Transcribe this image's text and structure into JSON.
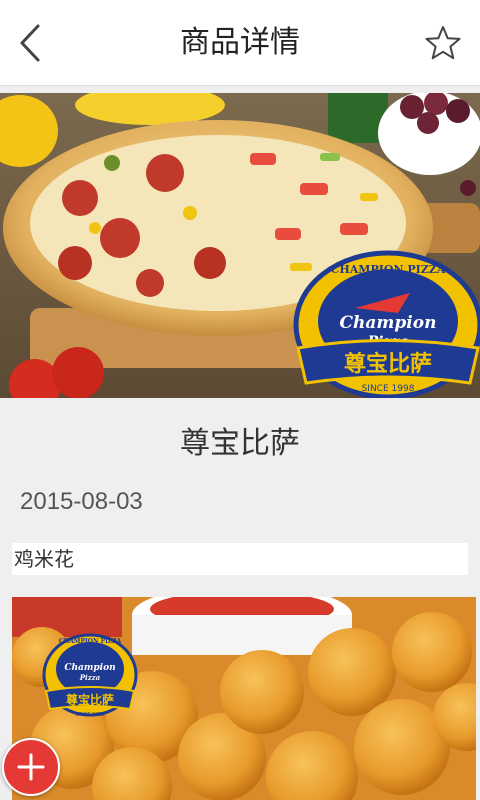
{
  "header": {
    "title": "商品详情",
    "back_icon": "chevron-left-icon",
    "favorite_icon": "star-outline-icon"
  },
  "hero": {
    "image": "pizza-photo",
    "logo": {
      "arc_text": "CHAMPION PIZZA",
      "script_line1": "Champion",
      "script_line2": "Pizza",
      "chinese": "尊宝比萨",
      "since": "SINCE 1998"
    }
  },
  "shop": {
    "name": "尊宝比萨"
  },
  "post": {
    "date": "2015-08-03"
  },
  "product": {
    "name": "鸡米花",
    "image": "popcorn-chicken-photo",
    "logo": {
      "arc_text": "CHAMPION PIZZA",
      "script_line1": "Champion",
      "script_line2": "Pizza",
      "chinese": "尊宝比萨",
      "since": "SINCE 1998"
    }
  },
  "fab": {
    "icon": "plus-icon"
  },
  "colors": {
    "accent_red": "#e53935",
    "logo_blue": "#1f3a93",
    "logo_gold": "#f2c200",
    "background": "#efefef"
  }
}
